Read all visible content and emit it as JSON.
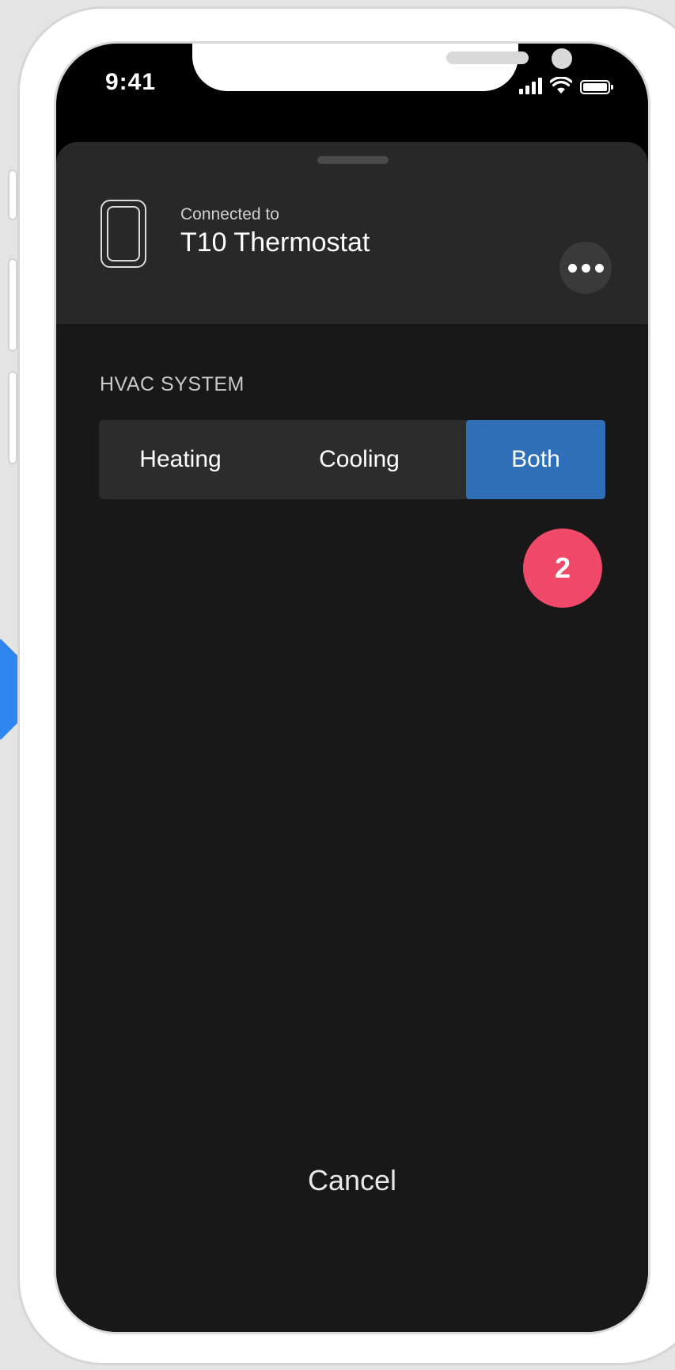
{
  "status_bar": {
    "time": "9:41",
    "icons": [
      "signal-icon",
      "wifi-icon",
      "battery-icon"
    ]
  },
  "header": {
    "device_icon": "thermostat-icon",
    "connected_label": "Connected to",
    "device_name": "T10 Thermostat",
    "more_icon": "more-horizontal-icon"
  },
  "hvac": {
    "section_label": "HVAC SYSTEM",
    "options": [
      "Heating",
      "Cooling",
      "Both"
    ],
    "selected": "Both"
  },
  "step_badge": "2",
  "cancel_label": "Cancel",
  "colors": {
    "accent": "#2e6fb8",
    "badge": "#f0496a",
    "sheet_background": "#181818",
    "header_background": "#282828"
  }
}
